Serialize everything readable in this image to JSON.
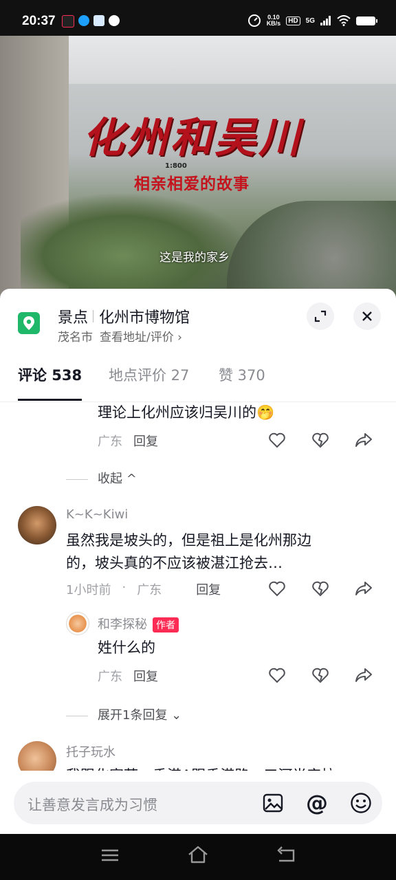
{
  "status_bar": {
    "time": "20:37",
    "net_speed_value": "0.10",
    "net_speed_unit": "KB/s",
    "hd": "HD",
    "signal": "5G"
  },
  "video": {
    "title": "化州和吴川",
    "scale": "1:800",
    "subtitle": "相亲相爱的故事",
    "caption": "这是我的家乡"
  },
  "place": {
    "category": "景点",
    "name": "化州市博物馆",
    "city": "茂名市",
    "address_link": "查看地址/评价 ›"
  },
  "tabs": [
    {
      "label": "评论 538"
    },
    {
      "label": "地点评价 27"
    },
    {
      "label": "赞 370"
    }
  ],
  "comments": {
    "partial": {
      "text": "理论上化州应该归吴川的🤭",
      "location": "广东",
      "reply_label": "回复"
    },
    "collapse_label": "收起 ^",
    "main": {
      "username": "K~K~Kiwi",
      "text_line1": "虽然我是坡头的，但是祖上是化州那边",
      "text_line2": "的，坡头真的不应该被湛江抢去…",
      "time": "1小时前",
      "dot": "·",
      "location": "广东",
      "reply_label": "回复"
    },
    "reply": {
      "username": "和李探秘",
      "badge": "作者",
      "text": "姓什么的",
      "location": "广东",
      "reply_label": "回复"
    },
    "expand_label": "展开1条回复 ⌄",
    "next": {
      "username": "托子玩水",
      "text": "我跟化家萍，香港A跟香港路，三河半实拉"
    }
  },
  "input": {
    "placeholder": "让善意发言成为习惯"
  },
  "colors": {
    "accent_red": "#fe2c55",
    "pin_green": "#1fb76a",
    "text_primary": "#161823",
    "text_secondary": "#8a8b91"
  }
}
